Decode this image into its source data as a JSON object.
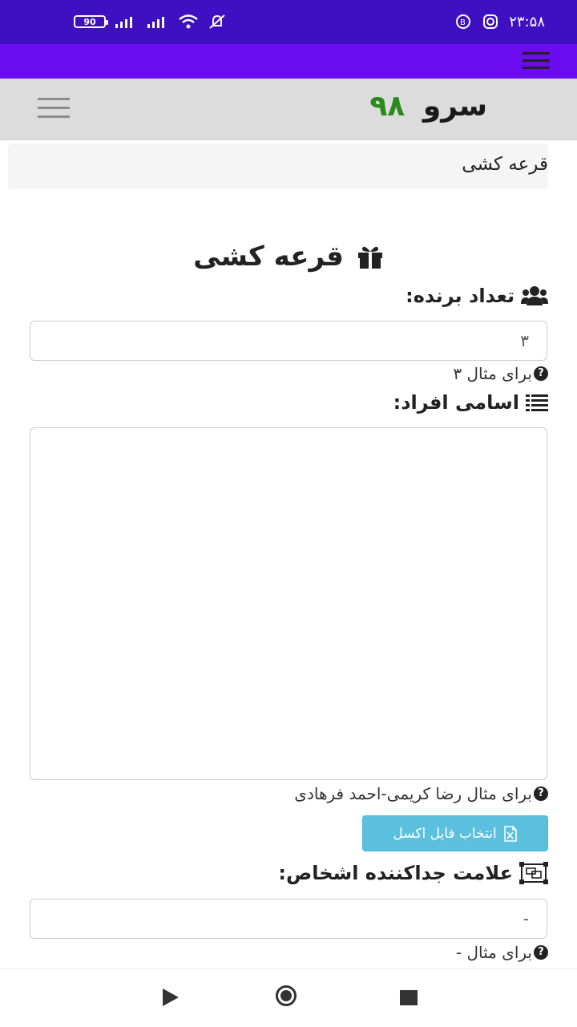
{
  "status_bar": {
    "battery": "90",
    "time": "۲۳:۵۸"
  },
  "header": {
    "logo_word": "سرو",
    "logo_number": "۹۸"
  },
  "breadcrumb": {
    "current": "قرعه کشی"
  },
  "main": {
    "title": "قرعه کشی",
    "winners_label": "تعداد برنده:",
    "winners_value": "۳",
    "winners_hint": "برای مثال ۳",
    "names_label": "اسامی افراد:",
    "names_value": "",
    "names_hint": "برای مثال رضا کریمی-احمد فرهادی",
    "excel_button": "انتخاب فایل اکسل",
    "separator_label": "علامت جداکننده اشخاص:",
    "separator_value": "-",
    "separator_hint": "برای مثال -"
  },
  "colors": {
    "status_bar": "#3f10c2",
    "top_bar": "#6a0bf0",
    "app_bar": "#dcdcdc",
    "logo_number": "#2b8a1e",
    "info_button": "#5bc0de"
  },
  "icons": {
    "gift": "gift-icon",
    "users": "users-icon",
    "list": "list-icon",
    "question": "question-circle-icon",
    "excel": "excel-file-icon",
    "separator": "object-group-icon"
  }
}
